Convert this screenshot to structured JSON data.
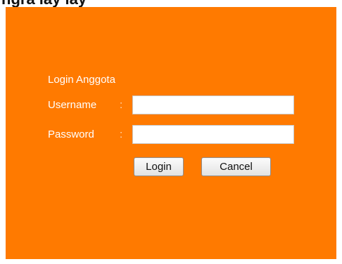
{
  "page": {
    "top_strip_text": "ngra lay        lay"
  },
  "form": {
    "title": "Login Anggota",
    "username_label": "Username",
    "password_label": "Password",
    "separator": ":",
    "username_value": "",
    "password_value": "",
    "login_label": "Login",
    "cancel_label": "Cancel"
  },
  "colors": {
    "panel_background": "#ff7a00",
    "label_text": "#ffffff"
  }
}
